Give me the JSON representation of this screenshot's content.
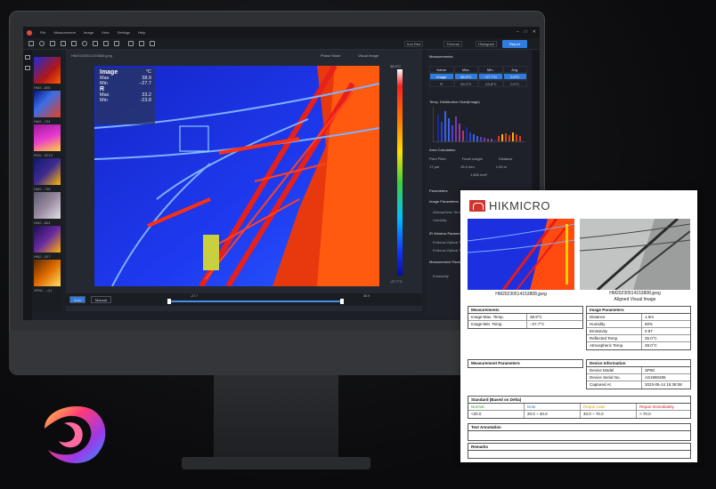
{
  "app": {
    "menu": [
      "File",
      "Measurement",
      "Image",
      "View",
      "Settings",
      "Help"
    ],
    "toolbar": {
      "palette": "Iron Red",
      "mode": "Thermal",
      "histogram": "Histogram",
      "report": "Report"
    },
    "viewer": {
      "filename": "HM20230514153808.jpeg",
      "tab_left": "Phase Mode",
      "tab_right": "Visual Image",
      "panel": {
        "title": "Image",
        "unit": "°C",
        "max_label": "Max",
        "max": "38.9",
        "min_label": "Min",
        "min": "−27.7",
        "r_title": "R",
        "r_max_label": "Max",
        "r_max": "33.2",
        "r_min_label": "Min",
        "r_min": "-23.8"
      },
      "scale_top": "38.9°C",
      "scale_bottom": "-27.7°C",
      "phase_button": "PhaseComm..."
    },
    "bottom": {
      "auto": "Auto",
      "manual": "Manual",
      "low": "-27.7",
      "high": "38.9"
    },
    "thumbnails": [
      "HM2...808",
      "HM2...704",
      "IR20...5213",
      "HM2...738",
      "HM2...804",
      "HM2...027",
      "SP60 ... (1)"
    ],
    "right": {
      "measurements_title": "Measurements",
      "table_headers": [
        "Name",
        "Max.",
        "Min.",
        "Avg."
      ],
      "table_rows": [
        [
          "Image",
          "38.9°C",
          "−27.7°C",
          "0.0°C"
        ],
        [
          "R",
          "33.2°C",
          "-23.8°C",
          "0.0°C"
        ]
      ],
      "hist_title": "Temp. Distribution Chart(Image)",
      "area_title": "Area Calculation",
      "area_headers": [
        "Pixel Pitch",
        "Focal Length",
        "Distance"
      ],
      "area_values": [
        "17 μm",
        "25.0 mm",
        "1.00 m"
      ],
      "area_result": "1,800 mm²",
      "params_title": "Parameters",
      "image_params": "Image Parameters",
      "atm_temp": "Atmospheric Temp.",
      "humidity": "Humidity",
      "ir_window": "IR Window Parameters",
      "ext_trans": "External Optical Transmi...",
      "ext_temp": "External Optical Tempera...",
      "meas_params": "Measurement Parameters",
      "emissivity": "Emissivity"
    }
  },
  "report": {
    "brand": "HIKMICRO",
    "caption1": "HM20230514153808.jpeg",
    "caption2a": "HM20230514153808.jpeg",
    "caption2b": "Aligned Visual Image",
    "measurements": {
      "title": "Measurements",
      "rows": [
        [
          "Image:Max. Temp.",
          "38.9°C"
        ],
        [
          "Image:Min. Temp.",
          "−27.7°C"
        ]
      ]
    },
    "image_params": {
      "title": "Image Parameters",
      "rows": [
        [
          "Distance",
          "1.0m"
        ],
        [
          "Humidity",
          "60%"
        ],
        [
          "Emissivity",
          "0.97"
        ],
        [
          "Reflected Temp.",
          "25.0°C"
        ],
        [
          "Atmospheric Temp.",
          "28.0°C"
        ]
      ]
    },
    "meas_params": {
      "title": "Measurement Parameters"
    },
    "device_info": {
      "title": "Device Information",
      "rows": [
        [
          "Device Model",
          "SP60"
        ],
        [
          "Device Serial No.",
          "AS1990485"
        ],
        [
          "Captured At",
          "2023-05-14 15:38:08"
        ]
      ]
    },
    "standard": {
      "title": "Standard (Based on Delta)",
      "labels": [
        "Normal",
        "Note",
        "Repair Later",
        "Repair Immediately"
      ],
      "values": [
        "<20.0",
        "20.0 ~ 40.0",
        "40.0 ~ 70.0",
        "> 70.0"
      ],
      "colors": [
        "#2aa52a",
        "#2f7de1",
        "#e0a000",
        "#d02020"
      ]
    },
    "annotation": "Text Annotation",
    "remarks": "Remarks"
  }
}
